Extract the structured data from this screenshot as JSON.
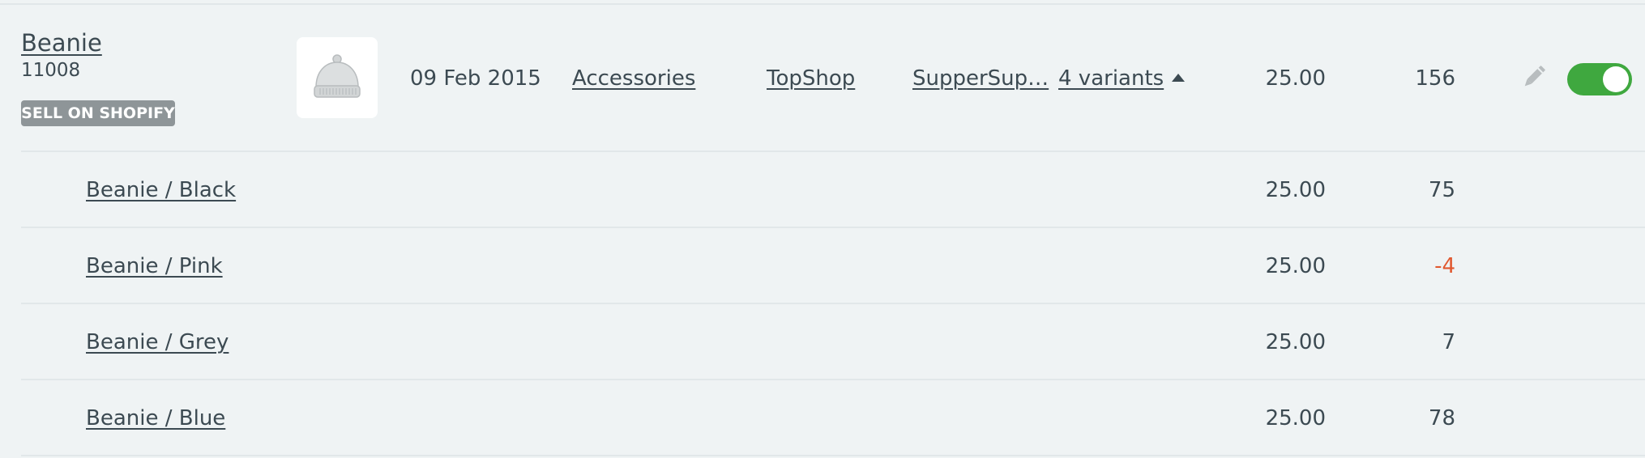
{
  "product": {
    "name": "Beanie",
    "sku": "11008",
    "badge": "SELL ON SHOPIFY",
    "image_icon": "beanie-hat-icon",
    "date": "09 Feb 2015",
    "category": "Accessories",
    "brand": "TopShop",
    "supplier": "SupperSup…",
    "variants_label": "4 variants",
    "price": "25.00",
    "stock": "156",
    "enabled": true
  },
  "variants": [
    {
      "name": "Beanie / Black",
      "price": "25.00",
      "stock": "75"
    },
    {
      "name": "Beanie / Pink",
      "price": "25.00",
      "stock": "-4"
    },
    {
      "name": "Beanie / Grey",
      "price": "25.00",
      "stock": "7"
    },
    {
      "name": "Beanie / Blue",
      "price": "25.00",
      "stock": "78"
    }
  ],
  "colors": {
    "background": "#eff3f4",
    "text": "#3c4a52",
    "negative_stock": "#e0582f",
    "toggle_on": "#3fa83f",
    "badge": "#8e9598"
  }
}
